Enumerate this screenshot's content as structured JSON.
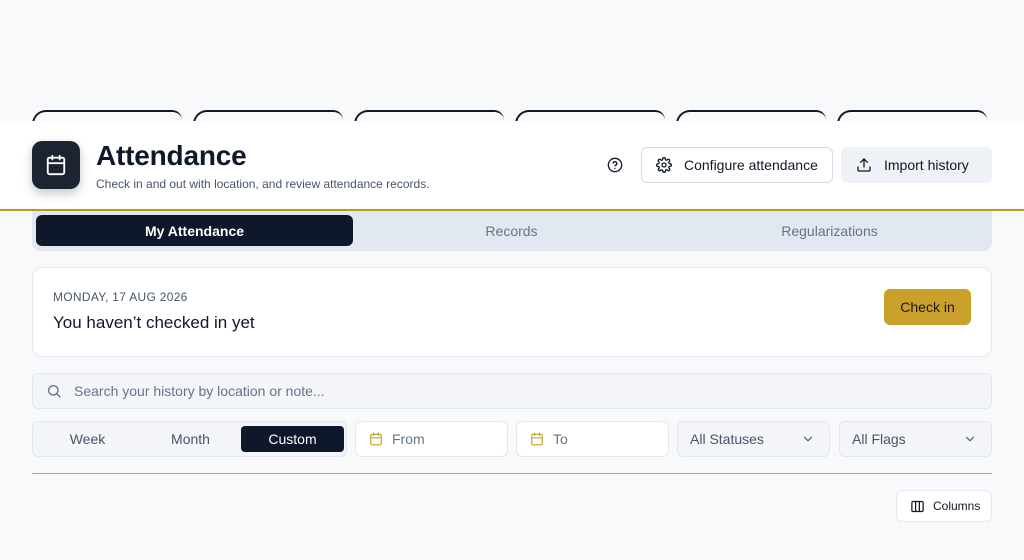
{
  "header": {
    "title": "Attendance",
    "subtitle": "Check in and out with location, and review attendance records.",
    "configure_label": "Configure attendance",
    "import_label": "Import history"
  },
  "tabs": [
    {
      "label": "My Attendance",
      "active": true
    },
    {
      "label": "Records",
      "active": false
    },
    {
      "label": "Regularizations",
      "active": false
    }
  ],
  "status_card": {
    "date": "MONDAY, 17 AUG 2026",
    "status": "You haven’t checked in yet",
    "checkin_label": "Check in"
  },
  "search": {
    "placeholder": "Search your history by location or note..."
  },
  "filters": {
    "range_options": [
      {
        "label": "Week",
        "active": false
      },
      {
        "label": "Month",
        "active": false
      },
      {
        "label": "Custom",
        "active": true
      }
    ],
    "from_placeholder": "From",
    "to_placeholder": "To",
    "status_select": "All Statuses",
    "flags_select": "All Flags"
  },
  "table_tools": {
    "columns_label": "Columns"
  },
  "colors": {
    "primary_dark": "#0f172a",
    "accent_gold": "#c9a12a",
    "header_border": "#b89a1c"
  },
  "icons": [
    "calendar-icon",
    "help-circle-icon",
    "gear-icon",
    "upload-icon",
    "search-icon",
    "chevron-down-icon",
    "columns-icon"
  ]
}
